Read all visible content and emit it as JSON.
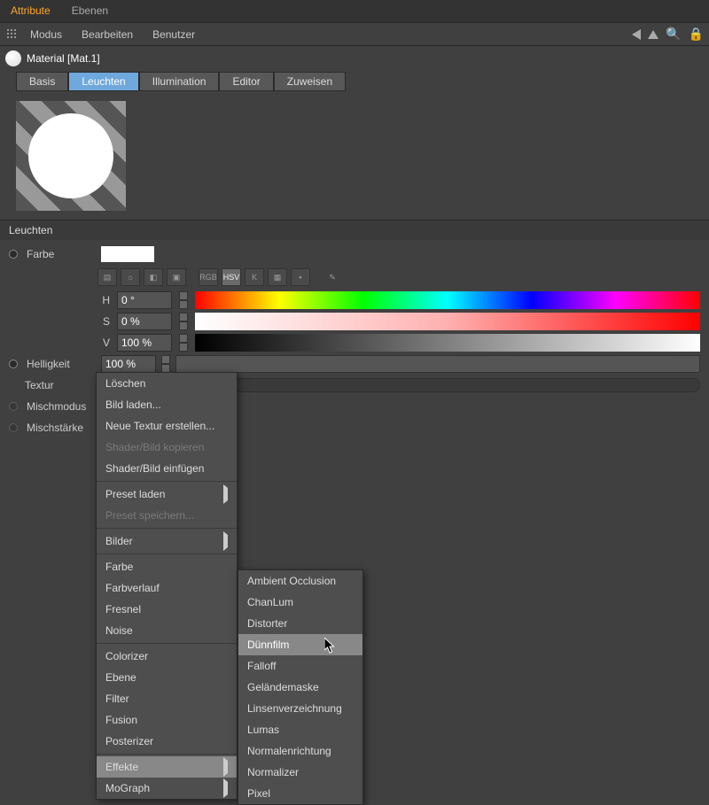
{
  "topTabs": {
    "active": "Attribute",
    "other": "Ebenen"
  },
  "menuBar": {
    "modus": "Modus",
    "bearbeiten": "Bearbeiten",
    "benutzer": "Benutzer"
  },
  "matHeader": {
    "name": "Material [Mat.1]"
  },
  "subTabs": {
    "basis": "Basis",
    "leuchten": "Leuchten",
    "illumination": "Illumination",
    "editor": "Editor",
    "zuweisen": "Zuweisen"
  },
  "sectionTitle": "Leuchten",
  "form": {
    "farbe": "Farbe",
    "h": "H",
    "hv": "0 °",
    "s": "S",
    "sv": "0 %",
    "v": "V",
    "vv": "100 %",
    "helligkeit": "Helligkeit",
    "hellv": "100 %",
    "textur": "Textur",
    "mischmodus": "Mischmodus",
    "mischstaerke": "Mischstärke",
    "iconRGB": "RGB",
    "iconHSV": "HSV",
    "iconK": "K"
  },
  "ctx1": {
    "loeschen": "Löschen",
    "bild_laden": "Bild laden...",
    "neue_textur": "Neue Textur erstellen...",
    "shader_kopieren": "Shader/Bild kopieren",
    "shader_einfuegen": "Shader/Bild einfügen",
    "preset_laden": "Preset laden",
    "preset_speichern": "Preset speichern...",
    "bilder": "Bilder",
    "farbe": "Farbe",
    "farbverlauf": "Farbverlauf",
    "fresnel": "Fresnel",
    "noise": "Noise",
    "colorizer": "Colorizer",
    "ebene": "Ebene",
    "filter": "Filter",
    "fusion": "Fusion",
    "posterizer": "Posterizer",
    "effekte": "Effekte",
    "mograph": "MoGraph"
  },
  "ctx2": {
    "ambient": "Ambient Occlusion",
    "chanlum": "ChanLum",
    "distorter": "Distorter",
    "duennfilm": "Dünnfilm",
    "falloff": "Falloff",
    "gelaende": "Geländemaske",
    "linsen": "Linsenverzeichnung",
    "lumas": "Lumas",
    "normalen": "Normalenrichtung",
    "normalizer": "Normalizer",
    "pixel": "Pixel"
  }
}
